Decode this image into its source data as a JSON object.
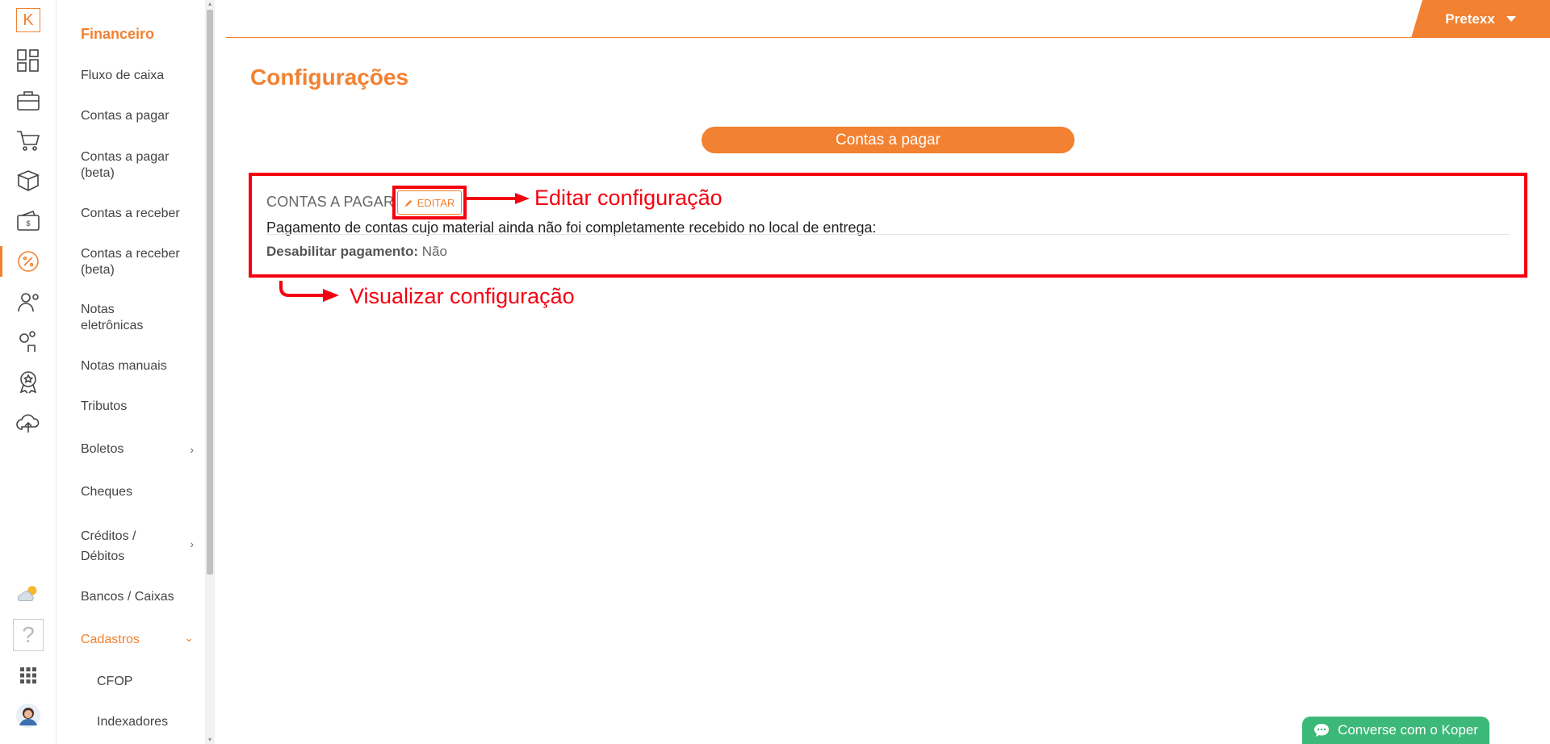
{
  "app": {
    "logo_letter": "K"
  },
  "rail": {
    "items": [
      {
        "icon": "dashboard-icon"
      },
      {
        "icon": "briefcase-icon"
      },
      {
        "icon": "shopping-cart-icon"
      },
      {
        "icon": "boxes-icon"
      },
      {
        "icon": "wallet-icon"
      },
      {
        "icon": "percent-icon"
      },
      {
        "icon": "worker-icon"
      },
      {
        "icon": "users-icon"
      },
      {
        "icon": "award-icon"
      },
      {
        "icon": "cloud-upload-icon"
      }
    ],
    "bottom": [
      {
        "icon": "weather-icon"
      },
      {
        "icon": "help-icon"
      },
      {
        "icon": "apps-grid-icon"
      },
      {
        "icon": "avatar"
      }
    ]
  },
  "submenu": {
    "title": "Financeiro",
    "items": [
      {
        "label": "Fluxo de caixa"
      },
      {
        "label": "Contas a pagar"
      },
      {
        "label": "Contas a pagar (beta)"
      },
      {
        "label": "Contas a receber"
      },
      {
        "label": "Contas a receber (beta)"
      },
      {
        "label": "Notas eletrônicas"
      },
      {
        "label": "Notas manuais"
      },
      {
        "label": "Tributos"
      },
      {
        "label": "Boletos"
      },
      {
        "label": "Cheques"
      },
      {
        "label": "Créditos / Débitos"
      },
      {
        "label": "Bancos / Caixas"
      },
      {
        "label": "Cadastros"
      },
      {
        "label": "CFOP"
      },
      {
        "label": "Indexadores"
      }
    ]
  },
  "header": {
    "user": "Pretexx"
  },
  "main": {
    "title": "Configurações",
    "section_button": "Contas a pagar",
    "card": {
      "heading": "CONTAS A PAGAR",
      "edit_label": "EDITAR",
      "description": "Pagamento de contas cujo material ainda não foi completamente recebido no local de entrega:",
      "field_label": "Desabilitar pagamento:",
      "field_value": "Não"
    }
  },
  "annotations": {
    "edit": "Editar configuração",
    "view": "Visualizar configuração"
  },
  "chat": {
    "label": "Converse com o Koper"
  },
  "colors": {
    "accent": "#f28131",
    "annotation": "#f5000f",
    "chat": "#3cb878"
  }
}
